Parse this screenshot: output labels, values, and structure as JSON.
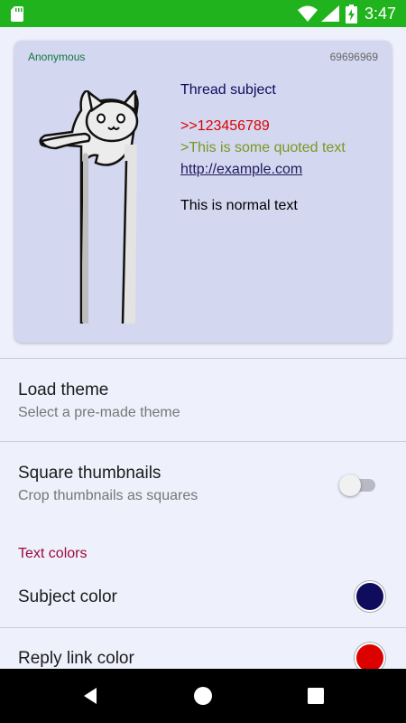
{
  "status_bar": {
    "time": "3:47",
    "color": "#21b31d",
    "icons": [
      "sd-card-icon",
      "wifi-icon",
      "signal-icon",
      "battery-charging-icon"
    ]
  },
  "preview_post": {
    "name": "Anonymous",
    "post_number": "69696969",
    "subject": "Thread subject",
    "reply_link": ">>123456789",
    "quote": ">This is some quoted text",
    "link": "http://example.com",
    "normal_text": "This is normal text",
    "thumbnail": "longcat-image"
  },
  "settings": {
    "load_theme": {
      "title": "Load theme",
      "summary": "Select a pre-made theme"
    },
    "square_thumbnails": {
      "title": "Square thumbnails",
      "summary": "Crop thumbnails as squares",
      "enabled": false
    },
    "text_colors_header": "Text colors",
    "subject_color": {
      "title": "Subject color",
      "color": "#0f0c5d"
    },
    "reply_link_color": {
      "title": "Reply link color",
      "color": "#dd0000"
    }
  },
  "nav_bar": {
    "buttons": [
      "back-icon",
      "home-icon",
      "recents-icon"
    ]
  }
}
